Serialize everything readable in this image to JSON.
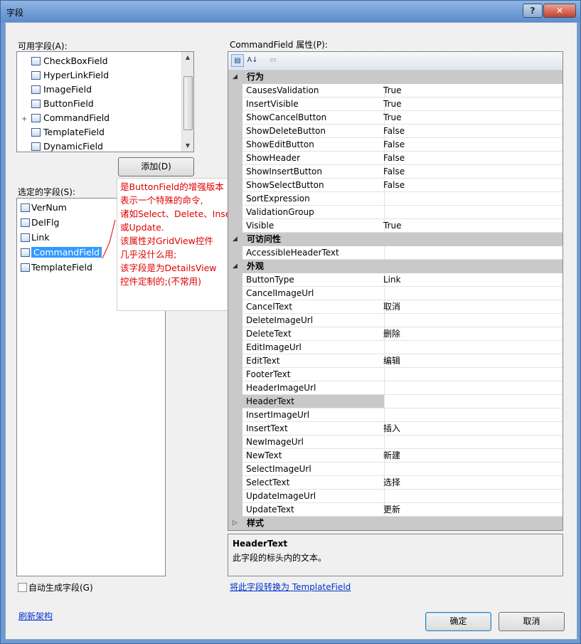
{
  "window": {
    "title": "字段",
    "help": "?",
    "close": "✕"
  },
  "available": {
    "label": "可用字段(A):",
    "items": [
      {
        "label": "CheckBoxField",
        "icon": "checkbox-field-icon",
        "expand": ""
      },
      {
        "label": "HyperLinkField",
        "icon": "hyperlink-field-icon",
        "expand": ""
      },
      {
        "label": "ImageField",
        "icon": "image-field-icon",
        "expand": ""
      },
      {
        "label": "ButtonField",
        "icon": "button-field-icon",
        "expand": ""
      },
      {
        "label": "CommandField",
        "icon": "command-field-icon",
        "expand": "+"
      },
      {
        "label": "TemplateField",
        "icon": "template-field-icon",
        "expand": ""
      },
      {
        "label": "DynamicField",
        "icon": "dynamic-field-icon",
        "expand": ""
      }
    ],
    "add_button": "添加(D)"
  },
  "selected": {
    "label": "选定的字段(S):",
    "items": [
      {
        "label": "VerNum",
        "icon": "bound-field-icon"
      },
      {
        "label": "DelFlg",
        "icon": "checkbox-field-icon"
      },
      {
        "label": "Link",
        "icon": "hyperlink-field-icon"
      },
      {
        "label": "CommandField",
        "icon": "command-field-icon"
      },
      {
        "label": "TemplateField",
        "icon": "template-field-icon"
      }
    ]
  },
  "annotation": {
    "lines": [
      "是ButtonField的增强版本",
      "表示一个特殊的命令,",
      "诸如Select、Delete、Insert",
      "或Update.",
      "该属性对GridView控件",
      "几乎没什么用;",
      "该字段是为DetailsView",
      "控件定制的;(不常用)"
    ]
  },
  "properties": {
    "label": "CommandField 属性(P):",
    "toolbar": {
      "categorized": "▤",
      "alphabetical": "A↓",
      "pages": "▭"
    },
    "rows": [
      {
        "type": "cat",
        "name": "行为",
        "toggle": "◢"
      },
      {
        "type": "prop",
        "name": "CausesValidation",
        "value": "True"
      },
      {
        "type": "prop",
        "name": "InsertVisible",
        "value": "True"
      },
      {
        "type": "prop",
        "name": "ShowCancelButton",
        "value": "True"
      },
      {
        "type": "prop",
        "name": "ShowDeleteButton",
        "value": "False"
      },
      {
        "type": "prop",
        "name": "ShowEditButton",
        "value": "False"
      },
      {
        "type": "prop",
        "name": "ShowHeader",
        "value": "False"
      },
      {
        "type": "prop",
        "name": "ShowInsertButton",
        "value": "False"
      },
      {
        "type": "prop",
        "name": "ShowSelectButton",
        "value": "False"
      },
      {
        "type": "prop",
        "name": "SortExpression",
        "value": ""
      },
      {
        "type": "prop",
        "name": "ValidationGroup",
        "value": ""
      },
      {
        "type": "prop",
        "name": "Visible",
        "value": "True"
      },
      {
        "type": "cat",
        "name": "可访问性",
        "toggle": "◢"
      },
      {
        "type": "prop",
        "name": "AccessibleHeaderText",
        "value": ""
      },
      {
        "type": "cat",
        "name": "外观",
        "toggle": "◢"
      },
      {
        "type": "prop",
        "name": "ButtonType",
        "value": "Link"
      },
      {
        "type": "prop",
        "name": "CancelImageUrl",
        "value": ""
      },
      {
        "type": "prop",
        "name": "CancelText",
        "value": "取消"
      },
      {
        "type": "prop",
        "name": "DeleteImageUrl",
        "value": ""
      },
      {
        "type": "prop",
        "name": "DeleteText",
        "value": "删除"
      },
      {
        "type": "prop",
        "name": "EditImageUrl",
        "value": ""
      },
      {
        "type": "prop",
        "name": "EditText",
        "value": "编辑"
      },
      {
        "type": "prop",
        "name": "FooterText",
        "value": ""
      },
      {
        "type": "prop",
        "name": "HeaderImageUrl",
        "value": ""
      },
      {
        "type": "prop",
        "name": "HeaderText",
        "value": "",
        "selected": true
      },
      {
        "type": "prop",
        "name": "InsertImageUrl",
        "value": ""
      },
      {
        "type": "prop",
        "name": "InsertText",
        "value": "插入"
      },
      {
        "type": "prop",
        "name": "NewImageUrl",
        "value": ""
      },
      {
        "type": "prop",
        "name": "NewText",
        "value": "新建"
      },
      {
        "type": "prop",
        "name": "SelectImageUrl",
        "value": ""
      },
      {
        "type": "prop",
        "name": "SelectText",
        "value": "选择"
      },
      {
        "type": "prop",
        "name": "UpdateImageUrl",
        "value": ""
      },
      {
        "type": "prop",
        "name": "UpdateText",
        "value": "更新"
      },
      {
        "type": "cat",
        "name": "样式",
        "toggle": "▷"
      }
    ],
    "description": {
      "title": "HeaderText",
      "text": "此字段的标头内的文本。"
    }
  },
  "convert_link": "将此字段转换为 TemplateField",
  "autogen": {
    "label": "自动生成字段(G)",
    "checked": false
  },
  "refresh_link": "刷新架构",
  "ok_button": "确定",
  "cancel_button": "取消"
}
